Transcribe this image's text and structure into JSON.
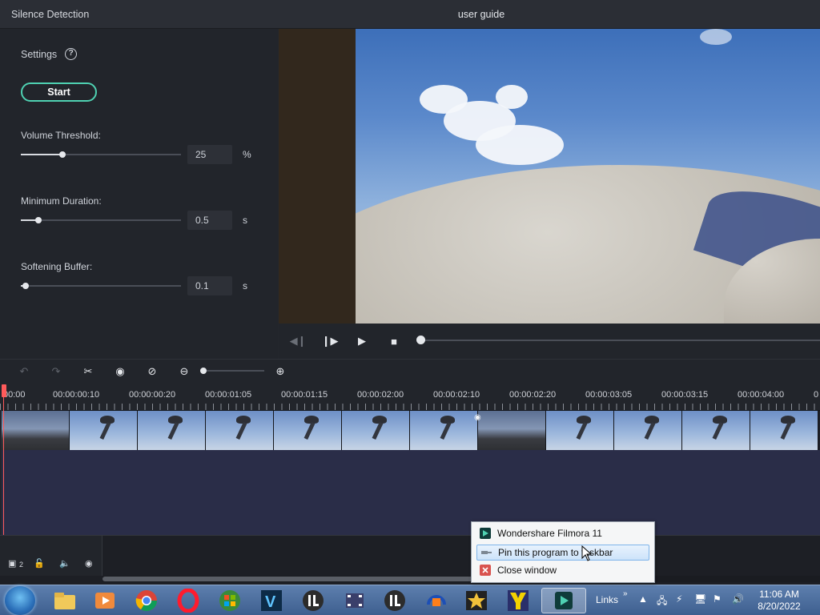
{
  "window": {
    "app_title": "Silence Detection",
    "doc_title": "user guide"
  },
  "settings": {
    "title": "Settings",
    "help_icon": "question-circle-icon",
    "start_label": "Start",
    "accent_color": "#4fd1b2",
    "params": [
      {
        "label": "Volume Threshold:",
        "value": "25",
        "unit": "%",
        "slider_fraction": 0.26
      },
      {
        "label": "Minimum Duration:",
        "value": "0.5",
        "unit": "s",
        "slider_fraction": 0.11
      },
      {
        "label": "Softening Buffer:",
        "value": "0.1",
        "unit": "s",
        "slider_fraction": 0.03
      }
    ]
  },
  "playback": {
    "progress_fraction": 0.0
  },
  "ruler": {
    "labels": [
      "00:00",
      "00:00:00:10",
      "00:00:00:20",
      "00:00:01:05",
      "00:00:01:15",
      "00:00:02:00",
      "00:00:02:10",
      "00:00:02:20",
      "00:00:03:05",
      "00:00:03:15",
      "00:00:04:00",
      "0"
    ]
  },
  "lower": {
    "track_count": "2"
  },
  "jumplist": {
    "items": [
      {
        "label": "Wondershare Filmora 11",
        "icon": "filmora-app-icon"
      },
      {
        "label": "Pin this program to taskbar",
        "icon": "pin-icon",
        "highlighted": true
      },
      {
        "label": "Close window",
        "icon": "close-window-icon"
      }
    ]
  },
  "taskbar": {
    "links_label": "Links",
    "time": "11:06 AM",
    "date": "8/20/2022"
  }
}
